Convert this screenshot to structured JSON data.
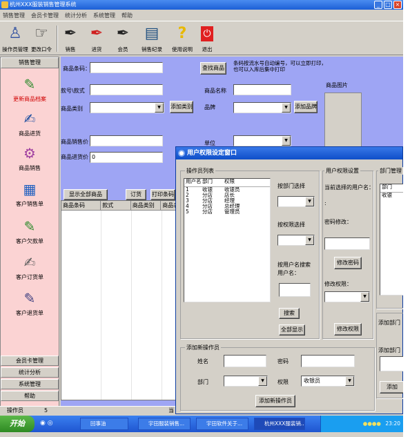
{
  "window": {
    "title": "杭州XXX服装销售管理系统"
  },
  "menu": [
    "销售管理",
    "会员卡管理",
    "统计分析",
    "系统管理",
    "帮助"
  ],
  "toolbar": {
    "items": [
      {
        "label": "操作员管理",
        "icon": "operator-icon"
      },
      {
        "label": "更改口令",
        "icon": "password-icon"
      },
      {
        "label": "销售",
        "icon": "pen-icon"
      },
      {
        "label": "进货",
        "icon": "red-pen-icon"
      },
      {
        "label": "会员",
        "icon": "pen-icon"
      },
      {
        "label": "销售纪录",
        "icon": "records-icon"
      },
      {
        "label": "使用说明",
        "icon": "help-icon"
      },
      {
        "label": "退出",
        "icon": "power-icon"
      }
    ]
  },
  "sidebar": {
    "header": "销售管理",
    "items": [
      {
        "label": "更新商品档案",
        "icon": "product-icon",
        "active": true
      },
      {
        "label": "商品进货",
        "icon": "stock-in-icon"
      },
      {
        "label": "商品销售",
        "icon": "sales-icon"
      },
      {
        "label": "客户销售单",
        "icon": "sales-order-icon"
      },
      {
        "label": "客户欠款单",
        "icon": "debt-icon"
      },
      {
        "label": "客户订货单",
        "icon": "order-icon"
      },
      {
        "label": "客户退货单",
        "icon": "return-icon"
      }
    ],
    "footer": [
      "会员卡管理",
      "统计分析",
      "系统管理",
      "帮助"
    ]
  },
  "form": {
    "barcode_label": "商品条码：",
    "search_button": "查找商品",
    "note": "条码按流水号自动编号，可以立即打印，\n也可以入库后集中打印",
    "image_label": "商品图片",
    "style_label": "款号\\款式",
    "name_label": "商品名称",
    "category_label": "商品类别",
    "add_category_button": "添加类别",
    "brand_label": "品牌",
    "add_brand_button": "添加品牌",
    "price_label": "商品销售价",
    "unit_label": "单位",
    "cost_label": "商品进货价",
    "cost_value": "0",
    "show_all_button": "显示全部商品",
    "order_button": "订货",
    "print_button": "打印条码",
    "grid_headers": [
      "商品条码",
      "款式",
      "商品类别",
      "商品名"
    ]
  },
  "status": {
    "operator_label": "操作员",
    "operator_value": "5",
    "current_label": "当"
  },
  "dialog": {
    "title": "用户权限设定窗口",
    "list_legend": "操作员列表",
    "list_headers": [
      "用户名",
      "部门",
      "权限"
    ],
    "rows": [
      [
        "1",
        "收银",
        "收银员"
      ],
      [
        "2",
        "分店",
        "店长"
      ],
      [
        "3",
        "分店",
        "经理"
      ],
      [
        "4",
        "分店",
        "总经理"
      ],
      [
        "5",
        "分店",
        "管理员"
      ]
    ],
    "dept_select_label": "按部门选择",
    "perm_select_label": "按权限选择",
    "username_search_label": "按用户名搜索\n用户名：",
    "search_button": "搜索",
    "show_all_button": "全部显示",
    "perm_set_legend": "用户权限设置",
    "current_user_label": "当前选择的用户名：",
    "current_user_value": ":",
    "password_edit_label": "密码修改：",
    "change_password_button": "修改密码",
    "perm_edit_label": "修改权限：",
    "change_perm_button": "修改权限",
    "dept_legend": "部门管理",
    "dept_header": "部门",
    "dept_rows": [
      "收银"
    ],
    "add_dept_legend": "添加部门",
    "add_dept_name_label": "添加部门",
    "add_button": "添加",
    "add_op_legend": "添加新操作员",
    "name_label": "姓名",
    "password_label": "密码",
    "dept_label": "部门",
    "perm_label": "权限",
    "perm_value": "收银员",
    "add_op_button": "添加新操作员"
  },
  "taskbar": {
    "start": "开始",
    "tasks": [
      "回事油",
      "宇田服装销售...",
      "宇田软件关于...",
      "杭州XXX服装销..."
    ],
    "clock": "23:20"
  }
}
